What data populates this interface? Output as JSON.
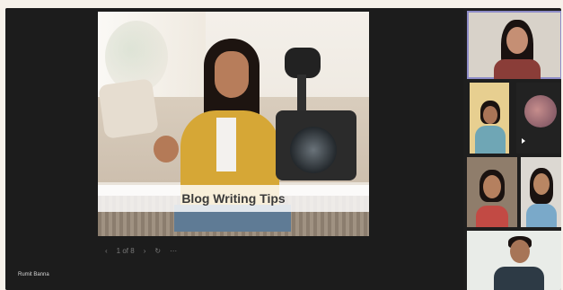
{
  "slide": {
    "caption": "Blog Writing Tips",
    "page_indicator": "1 of 8",
    "prev_icon": "chevron-left-icon",
    "next_icon": "chevron-right-icon",
    "more_icon": "more-dots-icon"
  },
  "presenter": {
    "name": "Rumit Banna"
  },
  "colors": {
    "stage_bg": "#1c1c1c",
    "active_speaker_outline": "#8e8cc8"
  },
  "participants": [
    {
      "id": "p1",
      "active": true
    },
    {
      "id": "p2"
    },
    {
      "id": "p3",
      "avatar": true
    },
    {
      "id": "p4"
    },
    {
      "id": "p5"
    },
    {
      "id": "p6"
    }
  ]
}
